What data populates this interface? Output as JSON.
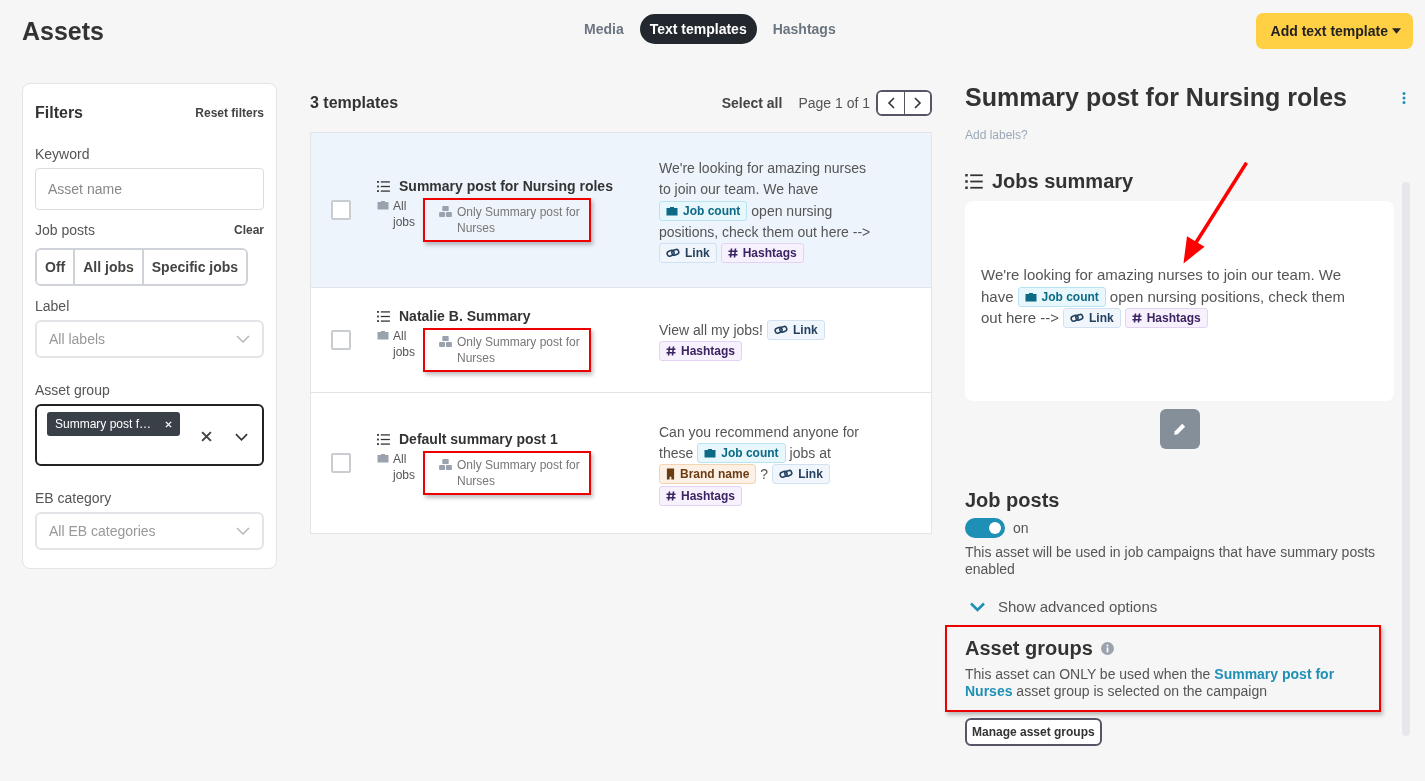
{
  "page_title": "Assets",
  "tabs": [
    {
      "label": "Media",
      "selected": false
    },
    {
      "label": "Text templates",
      "selected": true
    },
    {
      "label": "Hashtags",
      "selected": false
    }
  ],
  "add_button": "Add text template",
  "filters": {
    "title": "Filters",
    "reset": "Reset filters",
    "keyword": {
      "label": "Keyword",
      "placeholder": "Asset name"
    },
    "job_posts": {
      "label": "Job posts",
      "clear": "Clear",
      "options": [
        {
          "label": "Off",
          "selected": false
        },
        {
          "label": "All jobs",
          "selected": false
        },
        {
          "label": "Specific jobs",
          "selected": false
        }
      ]
    },
    "label": {
      "label": "Label",
      "placeholder": "All labels"
    },
    "asset_group": {
      "label": "Asset group",
      "chip": "Summary post f…",
      "focused": true
    },
    "eb_category": {
      "label": "EB category",
      "placeholder": "All EB categories"
    }
  },
  "list": {
    "count": "3 templates",
    "select_all": "Select all",
    "page": "Page 1 of 1",
    "rows": [
      {
        "title": "Summary post for Nursing roles",
        "jobs": "All jobs",
        "group": "Only Summary post for Nurses",
        "selected": true,
        "checked": false,
        "highlighted": true,
        "preview": [
          {
            "kind": "text",
            "text": "We're looking for amazing nurses"
          },
          {
            "kind": "text",
            "text": "to join our team. We have"
          },
          {
            "kind": "count",
            "text": "Job count"
          },
          {
            "kind": "text",
            "text": "open nursing"
          },
          {
            "kind": "text",
            "text": "positions, check them out here -->"
          },
          {
            "kind": "link",
            "text": "Link"
          },
          {
            "kind": "hashtags",
            "text": "Hashtags"
          }
        ]
      },
      {
        "title": "Natalie B. Summary",
        "jobs": "All jobs",
        "group": "Only Summary post for Nurses",
        "selected": false,
        "checked": false,
        "highlighted": true,
        "preview": [
          {
            "kind": "text",
            "text": "View all my jobs!"
          },
          {
            "kind": "link",
            "text": "Link"
          },
          {
            "kind": "hashtags",
            "text": "Hashtags"
          }
        ]
      },
      {
        "title": "Default summary post 1",
        "jobs": "All jobs",
        "group": "Only Summary post for Nurses",
        "selected": false,
        "checked": false,
        "highlighted": true,
        "preview": [
          {
            "kind": "text",
            "text": "Can you recommend anyone for"
          },
          {
            "kind": "text",
            "text": "these"
          },
          {
            "kind": "count",
            "text": "Job count"
          },
          {
            "kind": "text",
            "text": "jobs at"
          },
          {
            "kind": "brand",
            "text": "Brand name"
          },
          {
            "kind": "text",
            "text": "?"
          },
          {
            "kind": "link",
            "text": "Link"
          },
          {
            "kind": "hashtags",
            "text": "Hashtags"
          }
        ]
      }
    ]
  },
  "detail": {
    "title": "Summary post for Nursing roles",
    "add_labels": "Add labels?",
    "annotation_arrow": true,
    "section": "Jobs summary",
    "preview": [
      {
        "kind": "text",
        "text": "We're looking for amazing nurses to join our team. We"
      },
      {
        "kind": "text",
        "text": "have"
      },
      {
        "kind": "count",
        "text": "Job count"
      },
      {
        "kind": "text",
        "text": "open nursing positions, check them"
      },
      {
        "kind": "text",
        "text": "out here -->"
      },
      {
        "kind": "link",
        "text": "Link"
      },
      {
        "kind": "hashtags",
        "text": "Hashtags"
      }
    ],
    "job_posts": {
      "title": "Job posts",
      "on": true,
      "state": "on",
      "description": "This asset will be used in job campaigns that have summary posts enabled"
    },
    "advanced": "Show advanced options",
    "asset_groups": {
      "title": "Asset groups",
      "highlighted": true,
      "description": "This asset can ONLY be used when the **Summary post for Nurses** asset group is selected on the campaign",
      "manage": "Manage asset groups"
    }
  }
}
